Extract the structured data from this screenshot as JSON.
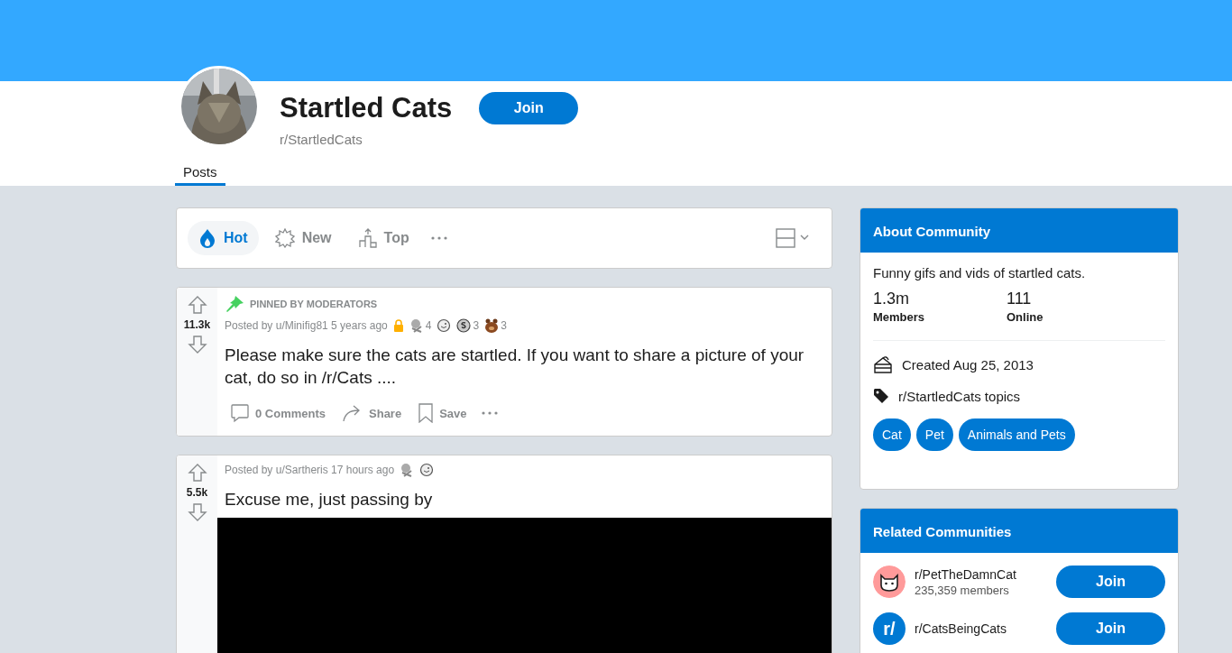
{
  "community": {
    "name": "Startled Cats",
    "handle": "r/StartledCats",
    "join_label": "Join"
  },
  "tabs": [
    {
      "label": "Posts",
      "selected": true
    }
  ],
  "sort": [
    {
      "label": "Hot",
      "kind": "hot",
      "selected": true
    },
    {
      "label": "New",
      "kind": "new",
      "selected": false
    },
    {
      "label": "Top",
      "kind": "top",
      "selected": false
    }
  ],
  "posts": [
    {
      "pinned_label": "PINNED BY MODERATORS",
      "votes": "11.3k",
      "posted_by": "Posted by u/Minifig81 5 years ago",
      "locked": true,
      "awards": [
        {
          "kind": "silver",
          "count": "4"
        },
        {
          "kind": "helpful"
        },
        {
          "kind": "coin",
          "count": "3"
        },
        {
          "kind": "bear",
          "count": "3"
        }
      ],
      "title": "Please make sure the cats are startled. If you want to share a picture of your cat, do so in /r/Cats ....",
      "actions": [
        {
          "kind": "comment",
          "label": "0 Comments"
        },
        {
          "kind": "share",
          "label": "Share"
        },
        {
          "kind": "save",
          "label": "Save"
        }
      ]
    },
    {
      "votes": "5.5k",
      "posted_by": "Posted by u/Sartheris 17 hours ago",
      "locked": false,
      "awards": [
        {
          "kind": "silver"
        },
        {
          "kind": "helpful"
        }
      ],
      "title": "Excuse me, just passing by",
      "media": {
        "kind": "video"
      }
    }
  ],
  "about": {
    "title": "About Community",
    "description": "Funny gifs and vids of startled cats.",
    "stats": [
      {
        "value": "1.3m",
        "label": "Members"
      },
      {
        "value": "111",
        "label": "Online"
      }
    ],
    "created": "Created Aug 25, 2013",
    "topics_label": "r/StartledCats topics",
    "topics": [
      "Cat",
      "Pet",
      "Animals and Pets"
    ]
  },
  "related": {
    "title": "Related Communities",
    "items": [
      {
        "name": "r/PetTheDamnCat",
        "members": "235,359 members",
        "kind": "cat",
        "join_label": "Join"
      },
      {
        "name": "r/CatsBeingCats",
        "kind": "letter",
        "icon_text": "r/",
        "join_label": "Join"
      }
    ]
  }
}
